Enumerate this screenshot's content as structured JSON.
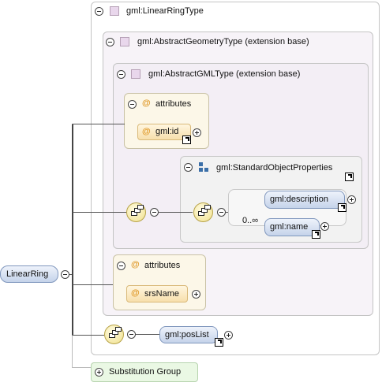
{
  "root_element": "LinearRing",
  "linear_ring_type": "gml:LinearRingType",
  "abstract_geometry_type": "gml:AbstractGeometryType (extension base)",
  "abstract_gml_type": "gml:AbstractGMLType (extension base)",
  "attributes_label_1": "attributes",
  "attr_id": "gml:id",
  "standard_object_properties": "gml:StandardObjectProperties",
  "description": "gml:description",
  "name": "gml:name",
  "name_cardinality": "0..∞",
  "attributes_label_2": "attributes",
  "attr_srsname": "srsName",
  "poslist": "gml:posList",
  "substitution_group": "Substitution Group",
  "colors": {
    "element_fill": "#c5d3ea",
    "attribute_fill": "#f7dfac",
    "attribute_box_fill": "#fcf7e8",
    "type_icon": "#e9d7ec",
    "group_icon": "#3b6fa8",
    "substitution_fill": "#eaf8e4",
    "sequence_fill": "#f0e08c"
  }
}
